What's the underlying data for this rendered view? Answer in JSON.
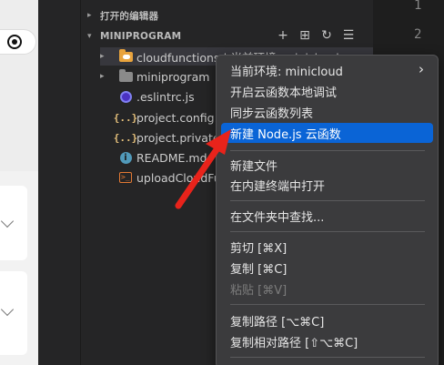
{
  "explorer": {
    "open_editors_label": "打开的编辑器",
    "project_label": "MINIPROGRAM",
    "header_actions": [
      "new-file-icon",
      "new-folder-icon",
      "refresh-icon",
      "collapse-all-icon"
    ],
    "tree": [
      {
        "label": "cloudfunctions | 当前环境: minicloud",
        "icon": "cloud-folder-icon",
        "twistie": "▸"
      },
      {
        "label": "miniprogram",
        "icon": "folder-icon",
        "twistie": "▸"
      },
      {
        "label": ".eslintrc.js",
        "icon": "eslint-icon",
        "twistie": ""
      },
      {
        "label": "project.config.json",
        "icon": "json-braces-icon",
        "twistie": ""
      },
      {
        "label": "project.private.config.json",
        "icon": "json-braces-icon",
        "twistie": ""
      },
      {
        "label": "README.md",
        "icon": "info-icon",
        "twistie": ""
      },
      {
        "label": "uploadCloudFunction.sh",
        "icon": "shell-icon",
        "twistie": ""
      }
    ]
  },
  "editor": {
    "line_numbers": [
      "1",
      "2"
    ]
  },
  "context_menu": {
    "items": [
      {
        "label": "当前环境: minicloud",
        "submenu_glyph": "›"
      },
      {
        "label": "开启云函数本地调试"
      },
      {
        "label": "同步云函数列表"
      },
      {
        "label": "新建 Node.js 云函数",
        "state": "highlighted"
      },
      {
        "label": "新建文件"
      },
      {
        "label": "在内建终端中打开"
      },
      {
        "label": "在文件夹中查找..."
      },
      {
        "label": "剪切 [⌘X]"
      },
      {
        "label": "复制 [⌘C]"
      },
      {
        "label": "粘贴 [⌘V]",
        "state": "disabled"
      },
      {
        "label": "复制路径 [⌥⌘C]"
      },
      {
        "label": "复制相对路径 [⇧⌥⌘C]"
      }
    ]
  },
  "colors": {
    "menu_highlight": "#0a64d6",
    "annotation_arrow": "#e8231b",
    "folder_accent": "#e8a33d"
  }
}
